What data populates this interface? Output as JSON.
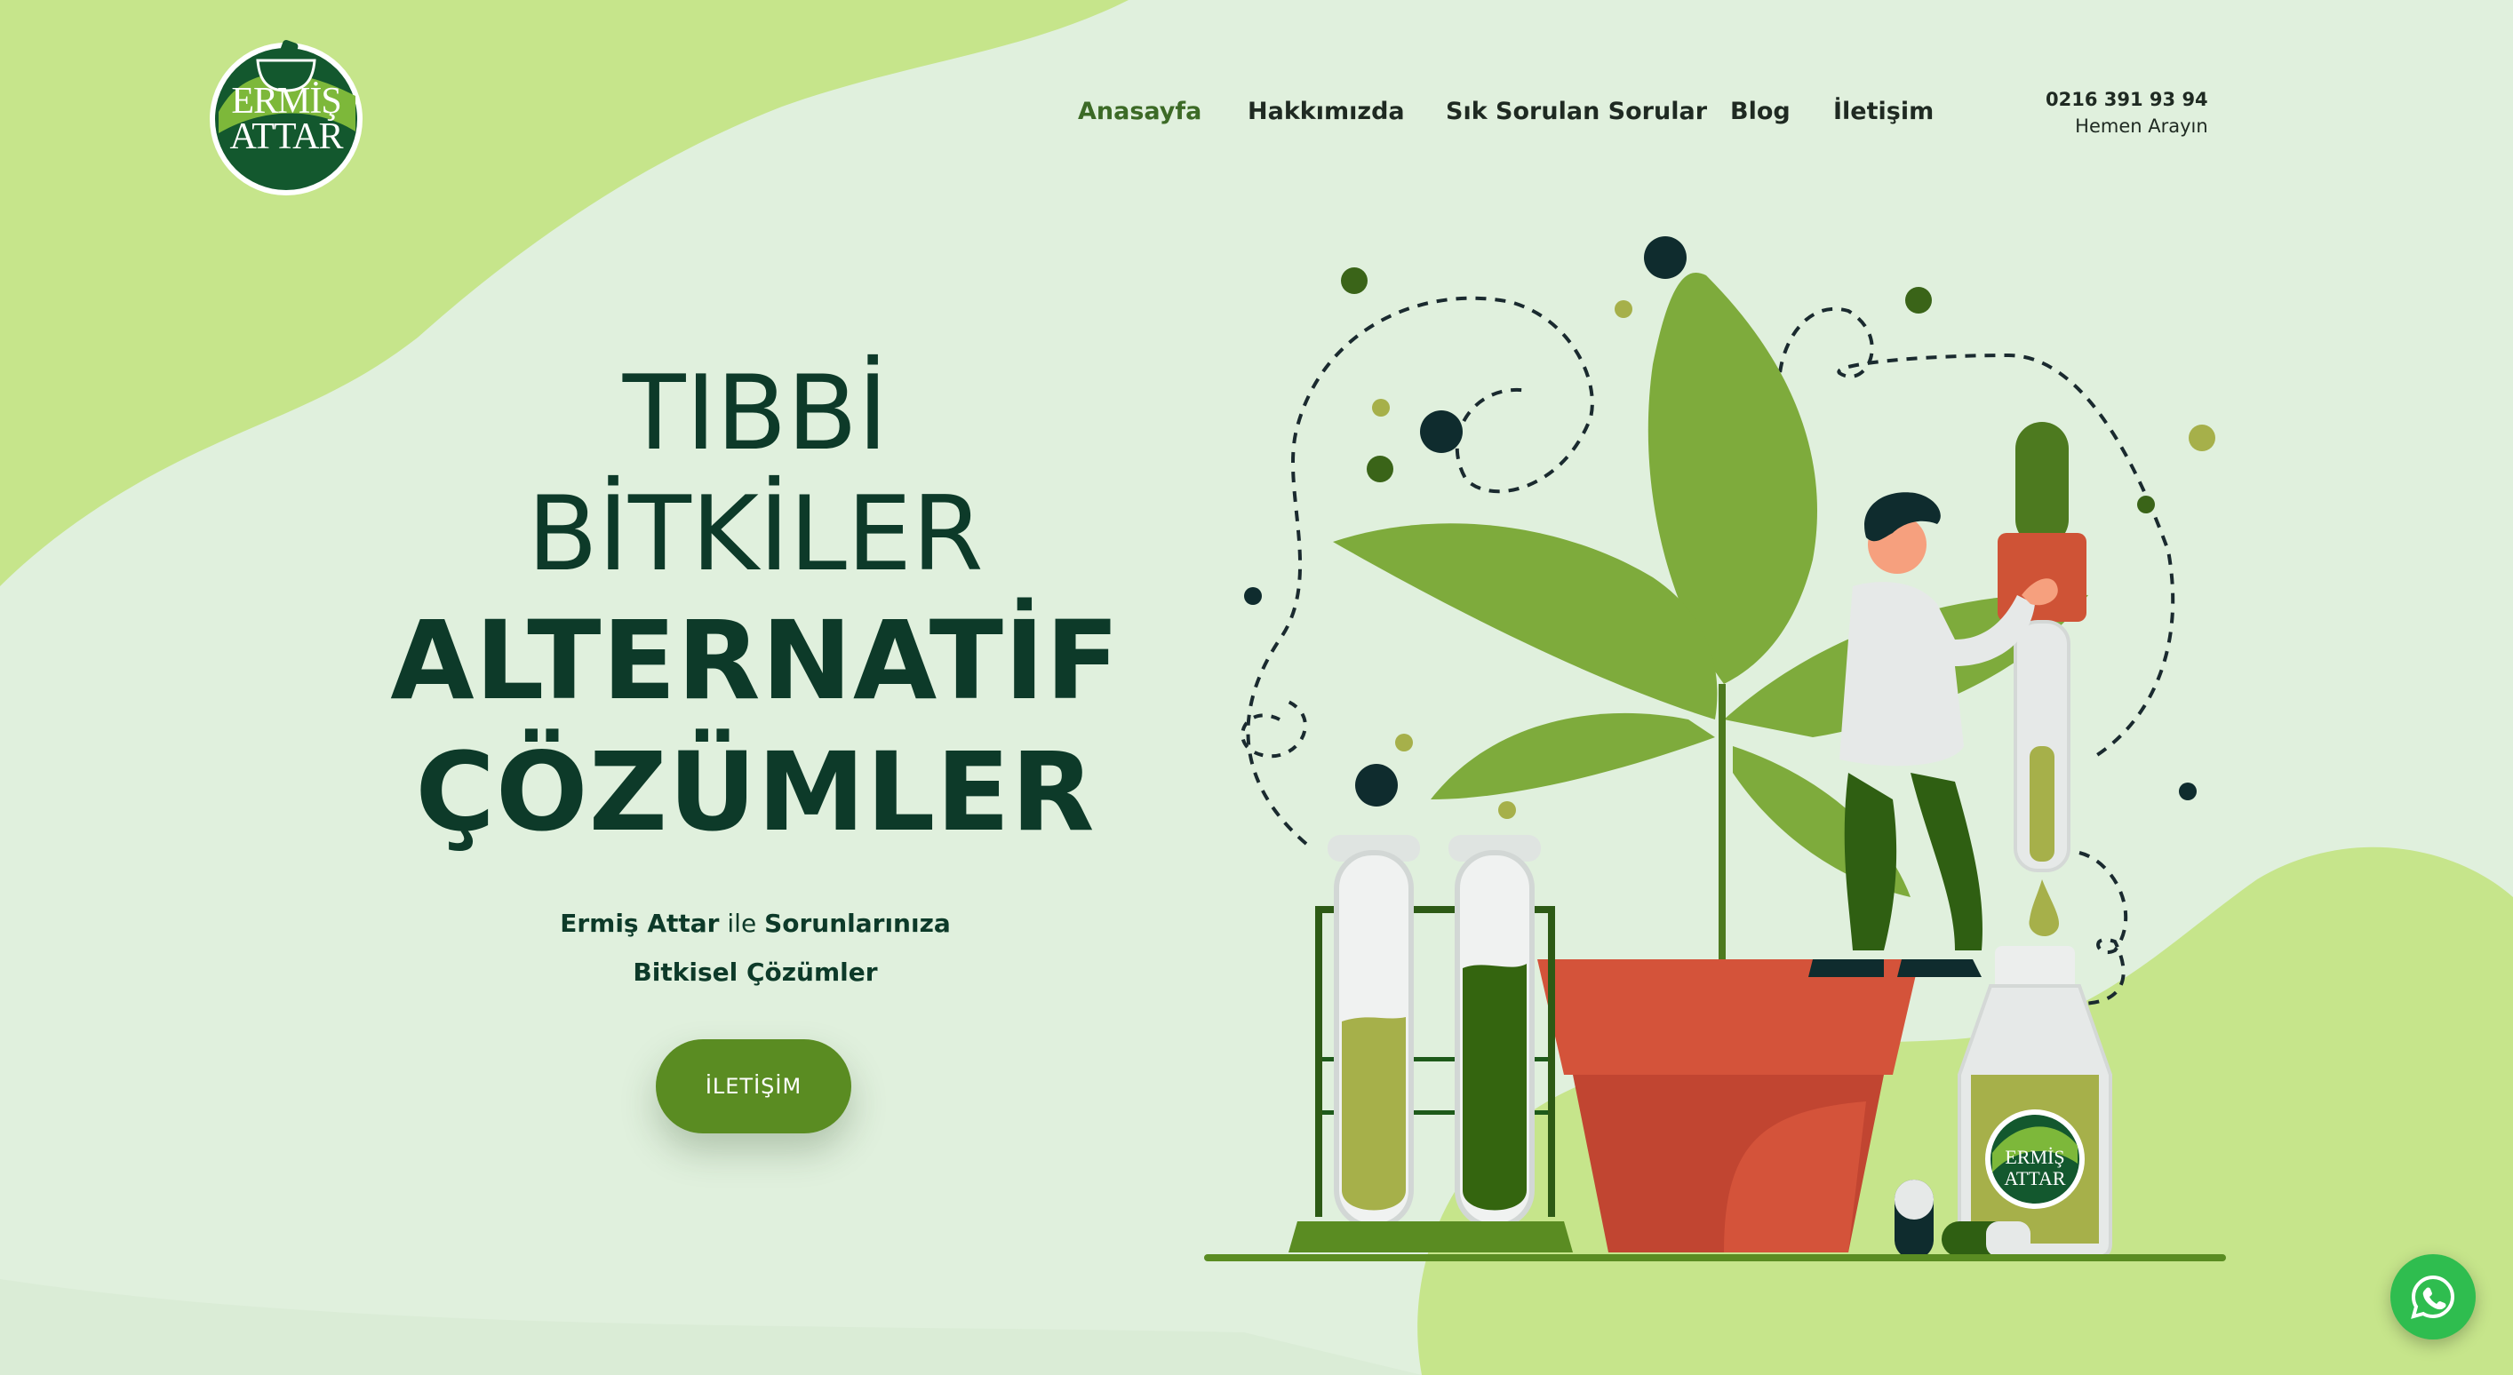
{
  "brand": {
    "logo_text_line1": "ERMİŞ",
    "logo_text_line2": "ATTAR",
    "colors": {
      "primary": "#5a8c22",
      "dark": "#0d3a29",
      "light_bg": "#e0f0dd",
      "accent_blob": "#c6e58b"
    }
  },
  "nav": {
    "items": [
      {
        "label": "Anasayfa",
        "active": true
      },
      {
        "label": "Hakkımızda",
        "active": false
      },
      {
        "label": "Sık Sorulan Sorular",
        "active": false
      },
      {
        "label": "Blog",
        "active": false
      },
      {
        "label": "İletişim",
        "active": false
      }
    ]
  },
  "contact": {
    "phone": "0216 391 93 94",
    "call_label": "Hemen Arayın"
  },
  "hero": {
    "title_line1": "TIBBİ",
    "title_line2": "BİTKİLER",
    "title_line3": "ALTERNATİF",
    "title_line4": "ÇÖZÜMLER",
    "subtitle_brand": "Ermiş Attar",
    "subtitle_connector": " ile ",
    "subtitle_rest": "Sorunlarınıza",
    "subtitle_line2": "Bitkisel Çözümler",
    "cta_label": "İLETİŞİM"
  },
  "bottle_label": {
    "line1": "ERMİŞ",
    "line2": "ATTAR"
  },
  "icons": [
    "whatsapp-icon",
    "mortar-pestle-icon"
  ]
}
